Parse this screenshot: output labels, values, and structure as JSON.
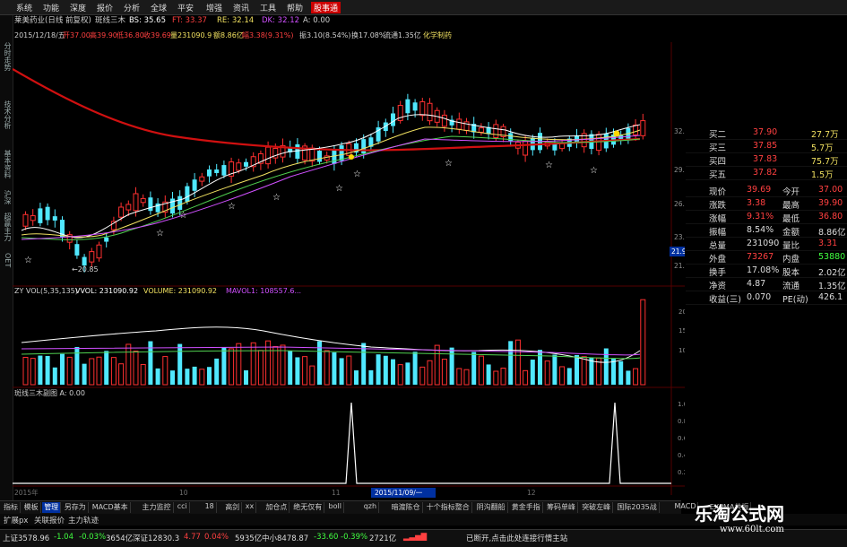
{
  "menu": {
    "items": [
      "系统",
      "功能",
      "深度",
      "报价",
      "分析",
      "全球",
      "平安",
      "增强",
      "资讯",
      "工具",
      "帮助"
    ],
    "highlight": "股事通"
  },
  "left_tabs": [
    "分时走势",
    "技术分析",
    "基本资料",
    "沪深",
    "超赢主力",
    "OET"
  ],
  "header": {
    "stock": "莱美药业(日线 前复权)",
    "indicator": "斑线三木",
    "bs": "BS: 35.65",
    "ft": "FT: 33.37",
    "re": "RE: 32.14",
    "dk": "DK: 32.12",
    "a": "A: 0.00",
    "line2_date": "2015/12/18/五",
    "line2_open": "开37.00",
    "line2_high": "高39.90",
    "line2_low": "低36.80",
    "line2_close": "收39.69",
    "line2_vol": "量231090.9",
    "line2_amt": "额8.86亿",
    "line2_chg": "幅3.38(9.31%)",
    "line2_amp": "振3.10(8.54%)",
    "line2_turn": "换17.08%",
    "line2_float": "流通1.35亿",
    "line2_sector": "化学制药"
  },
  "price_axis": [
    "32.69",
    "29.43",
    "26.43",
    "23.43",
    "21.45"
  ],
  "price_marker": "21.92",
  "low_label": "←20.85",
  "vol_header": {
    "name": "ZY VOL(5,35,135)",
    "vvol": "VVOL: 231090.92",
    "volume": "VOLUME: 231090.92",
    "mavol": "MAVOL1: 108557.6..."
  },
  "vol_axis": [
    "20000",
    "15000",
    "10000"
  ],
  "signal_header": "斑线三木副图 A: 0.00",
  "signal_axis": [
    "1.00",
    "0.80",
    "0.60",
    "0.40",
    "0.20"
  ],
  "date_axis": {
    "left": "2015年",
    "m10": "10",
    "m11": "11",
    "m12": "12",
    "marker": "2015/11/09/一"
  },
  "quote": [
    {
      "l": "买二",
      "v": "37.90",
      "r": "27.7万",
      "vc": "#ff4040"
    },
    {
      "l": "买三",
      "v": "37.85",
      "r": "5.7万",
      "vc": "#ff4040"
    },
    {
      "l": "买四",
      "v": "37.83",
      "r": "75.7万",
      "vc": "#ff4040"
    },
    {
      "l": "买五",
      "v": "37.82",
      "r": "1.5万",
      "vc": "#ff4040"
    }
  ],
  "stats": [
    {
      "l": "现价",
      "v": "39.69",
      "m": "今开",
      "r": "37.00",
      "vc": "#ff4040",
      "rc": "#ff4040"
    },
    {
      "l": "涨跌",
      "v": "3.38",
      "m": "最高",
      "r": "39.90",
      "vc": "#ff4040",
      "rc": "#ff4040"
    },
    {
      "l": "涨幅",
      "v": "9.31%",
      "m": "最低",
      "r": "36.80",
      "vc": "#ff4040",
      "rc": "#ff4040"
    },
    {
      "l": "振幅",
      "v": "8.54%",
      "m": "金额",
      "r": "8.86亿",
      "vc": "#dddddd",
      "rc": "#dddddd"
    },
    {
      "l": "总量",
      "v": "231090",
      "m": "量比",
      "r": "3.31",
      "vc": "#dddddd",
      "rc": "#ff4040"
    },
    {
      "l": "外盘",
      "v": "73267",
      "m": "内盘",
      "r": "53880",
      "vc": "#ff4040",
      "rc": "#40ff40"
    },
    {
      "l": "换手",
      "v": "17.08%",
      "m": "股本",
      "r": "2.02亿",
      "vc": "#dddddd",
      "rc": "#dddddd"
    },
    {
      "l": "净资",
      "v": "4.87",
      "m": "流通",
      "r": "1.35亿",
      "vc": "#dddddd",
      "rc": "#dddddd"
    },
    {
      "l": "收益(三)",
      "v": "0.070",
      "m": "PE(动)",
      "r": "426.1",
      "vc": "#dddddd",
      "rc": "#dddddd"
    }
  ],
  "bottom_tabs": [
    "指标",
    "模板",
    "管理",
    "另存为",
    "MACD基本",
    "主力监控",
    "cci",
    "18",
    "高剑",
    "xx",
    "加仓点",
    "绝无仅有",
    "boll",
    "qzh",
    "暗渡陈仓",
    "十个指标整合",
    "阴沟翻船",
    "黄金手指",
    "筹码单峰",
    "突破左峰",
    "国际2035战",
    "MACD",
    "EXPMA共振"
  ],
  "toolbar2": [
    "扩展px",
    "关联报价",
    "主力轨迹"
  ],
  "status": {
    "sh": "上证3578.96",
    "sh_chg": "-1.04",
    "sh_pct": "-0.03%",
    "sh_amt": "3654亿",
    "sz": "深证12830.3",
    "sz_chg": "4.77",
    "sz_pct": "0.04%",
    "sz_amt": "5935亿",
    "zx": "中小8478.87",
    "zx_chg": "-33.60",
    "zx_pct": "-0.39%",
    "zx_amt": "2721亿",
    "msg": "已断开,点击此处连接行情主站"
  },
  "watermark": {
    "title": "乐淘公式网",
    "url": "www.60lt.com"
  },
  "colors": {
    "up": "#ff3030",
    "down": "#50e8ff",
    "ma_long": "#d01010",
    "ma_white": "#ffffff",
    "ma_yellow": "#f0e060",
    "ma_green": "#50d050",
    "ma_purple": "#d050ff"
  }
}
